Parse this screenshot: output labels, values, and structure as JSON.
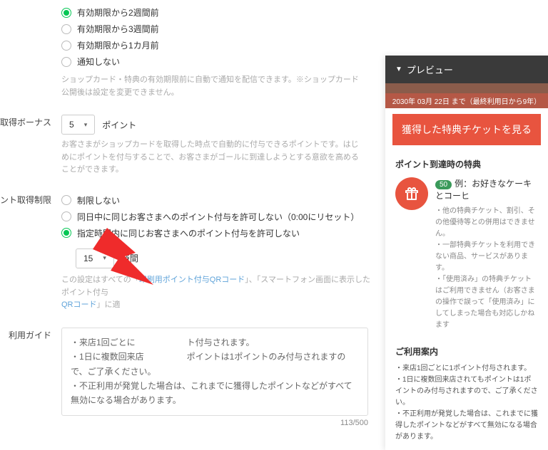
{
  "expiry": {
    "options": [
      {
        "label": "有効期限から2週間前",
        "checked": true
      },
      {
        "label": "有効期限から3週間前",
        "checked": false
      },
      {
        "label": "有効期限から1カ月前",
        "checked": false
      },
      {
        "label": "通知しない",
        "checked": false
      }
    ],
    "helper": "ショップカード・特典の有効期限前に自動で通知を配信できます。※ショップカード公開後は設定を変更できません。"
  },
  "bonus": {
    "label": "取得ボーナス",
    "value": "5",
    "unit": "ポイント",
    "helper": "お客さまがショップカードを取得した時点で自動的に付与できるポイントです。はじめにポイントを付与することで、お客さまがゴールに到達しようとする意欲を高めることができます。"
  },
  "limit": {
    "label": "ント取得制限",
    "options": [
      {
        "label": "制限しない",
        "checked": false
      },
      {
        "label": "同日中に同じお客さまへのポイント付与を許可しない（0:00にリセット）",
        "checked": false
      },
      {
        "label": "指定時間内に同じお客さまへのポイント付与を許可しない",
        "checked": true
      }
    ],
    "hours_value": "15",
    "hours_unit": "時間",
    "qr_note_a": "この設定はすべての「",
    "qr_note_link1": "印刷用ポイント付与QRコード",
    "qr_note_b": "」、「スマートフォン画面に表示したポイント付与",
    "qr_note_link2": "QRコード",
    "qr_note_c": "」に適"
  },
  "guide": {
    "label": "利用ガイド",
    "text": "・来店1回ごとに　　　　　　ト付与されます。\n・1日に複数回来店　　　　　ポイントは1ポイントのみ付与されますので、ご了承ください。\n・不正利用が発覚した場合は、これまでに獲得したポイントなどがすべて無効になる場合があります。",
    "count": "113",
    "max": "500"
  },
  "preview": {
    "title": "プレビュー",
    "date_line": "2030年 03月 22日 まで（最終利用日から9年）",
    "ticket_btn": "獲得した特典チケットを見る",
    "reward_header": "ポイント到達時の特典",
    "badge": "50",
    "example_title": "例：お好きなケーキとコーヒ",
    "notes": [
      "・他の特典チケット、割引、その他優待等との併用はできません。",
      "・一部特典チケットを利用できない商品、サービスがあります。",
      "・「使用済み」の特典チケットはご利用できません（お客さまの操作で誤って「使用済み」にしてしまった場合も対応しかねます"
    ],
    "guide_header": "ご利用案内",
    "guides": [
      "・来店1回ごとに1ポイント付与されます。",
      "・1日に複数回来店されてもポイントは1ポイントのみ付与されますので、ご了承ください。",
      "・不正利用が発覚した場合は、これまでに獲得したポイントなどがすべて無効になる場合があります。"
    ]
  }
}
